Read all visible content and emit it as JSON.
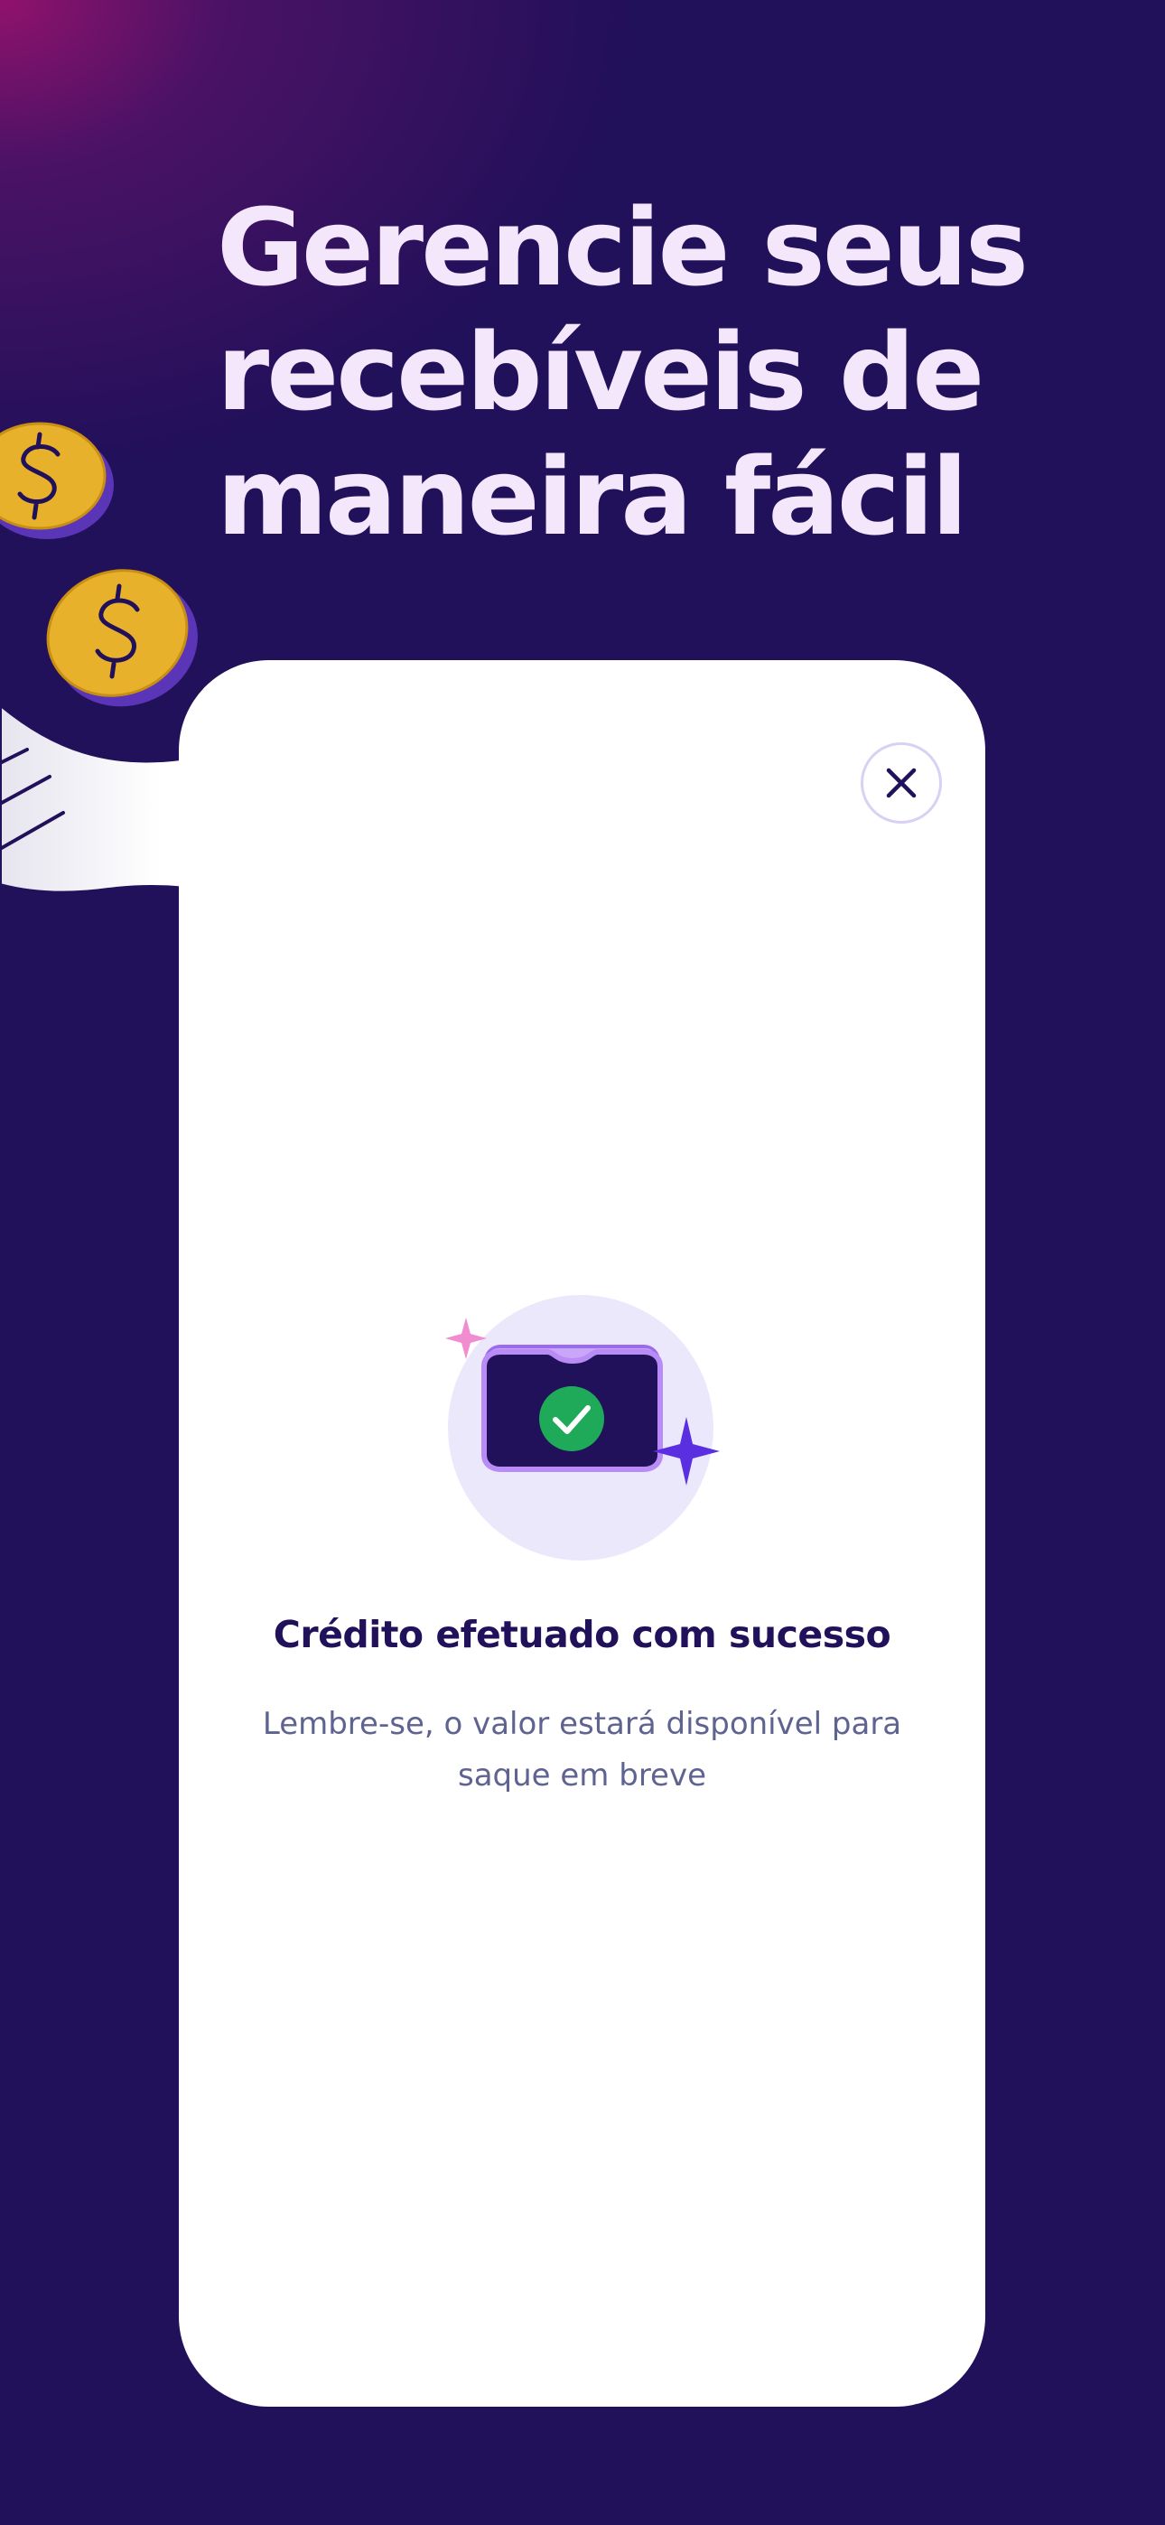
{
  "headline": {
    "line1": "Gerencie seus",
    "line2": "recebíveis de",
    "line3": "maneira fácil"
  },
  "modal": {
    "close_icon": "close-icon",
    "illustration_icon": "wallet-check-icon",
    "title": "Crédito efetuado com sucesso",
    "message": "Lembre-se, o valor estará disponível para saque em breve"
  },
  "colors": {
    "background": "#21105a",
    "headline": "#f4e6fb",
    "card": "#ffffff",
    "title": "#21105a",
    "message": "#5f6390",
    "success": "#1faa59",
    "coin": "#e8b12c",
    "accent_purple": "#5a2fe0",
    "accent_pink": "#f08ccf"
  }
}
